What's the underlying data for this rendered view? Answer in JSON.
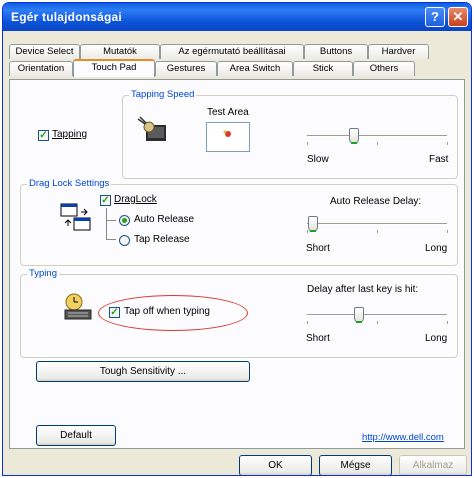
{
  "window": {
    "title": "Egér tulajdonságai"
  },
  "tabs_row1": [
    {
      "label": "Device Select"
    },
    {
      "label": "Mutatók"
    },
    {
      "label": "Az egérmutató beállításai"
    },
    {
      "label": "Buttons"
    },
    {
      "label": "Hardver"
    }
  ],
  "tabs_row2": [
    {
      "label": "Orientation"
    },
    {
      "label": "Touch Pad",
      "active": true
    },
    {
      "label": "Gestures"
    },
    {
      "label": "Area Switch"
    },
    {
      "label": "Stick"
    },
    {
      "label": "Others"
    }
  ],
  "tapping": {
    "legend": "Tapping Speed",
    "checkbox_label": "Tapping",
    "checked": true,
    "test_area_label": "Test Area",
    "slow_label": "Slow",
    "fast_label": "Fast",
    "speed_value": 0.55
  },
  "drag_lock": {
    "legend": "Drag Lock Settings",
    "checkbox_label": "DragLock",
    "checked": true,
    "radio_auto": "Auto Release",
    "radio_tap": "Tap Release",
    "selected": "auto",
    "delay_label": "Auto Release Delay:",
    "short_label": "Short",
    "long_label": "Long",
    "delay_value": 0.0
  },
  "typing": {
    "legend": "Typing",
    "checkbox_label": "Tap off when typing",
    "checked": true,
    "delay_label": "Delay after last key is hit:",
    "short_label": "Short",
    "long_label": "Long",
    "delay_value": 0.5
  },
  "touch_sensitivity_label": "Tough Sensitivity ...",
  "default_label": "Default",
  "link_text": "http://www.dell.com",
  "footer": {
    "ok": "OK",
    "cancel": "Mégse",
    "apply": "Alkalmaz"
  },
  "colors": {
    "accent": "#0046d5",
    "titlebar": "#0b52d6",
    "highlight": "#d83a2e"
  }
}
